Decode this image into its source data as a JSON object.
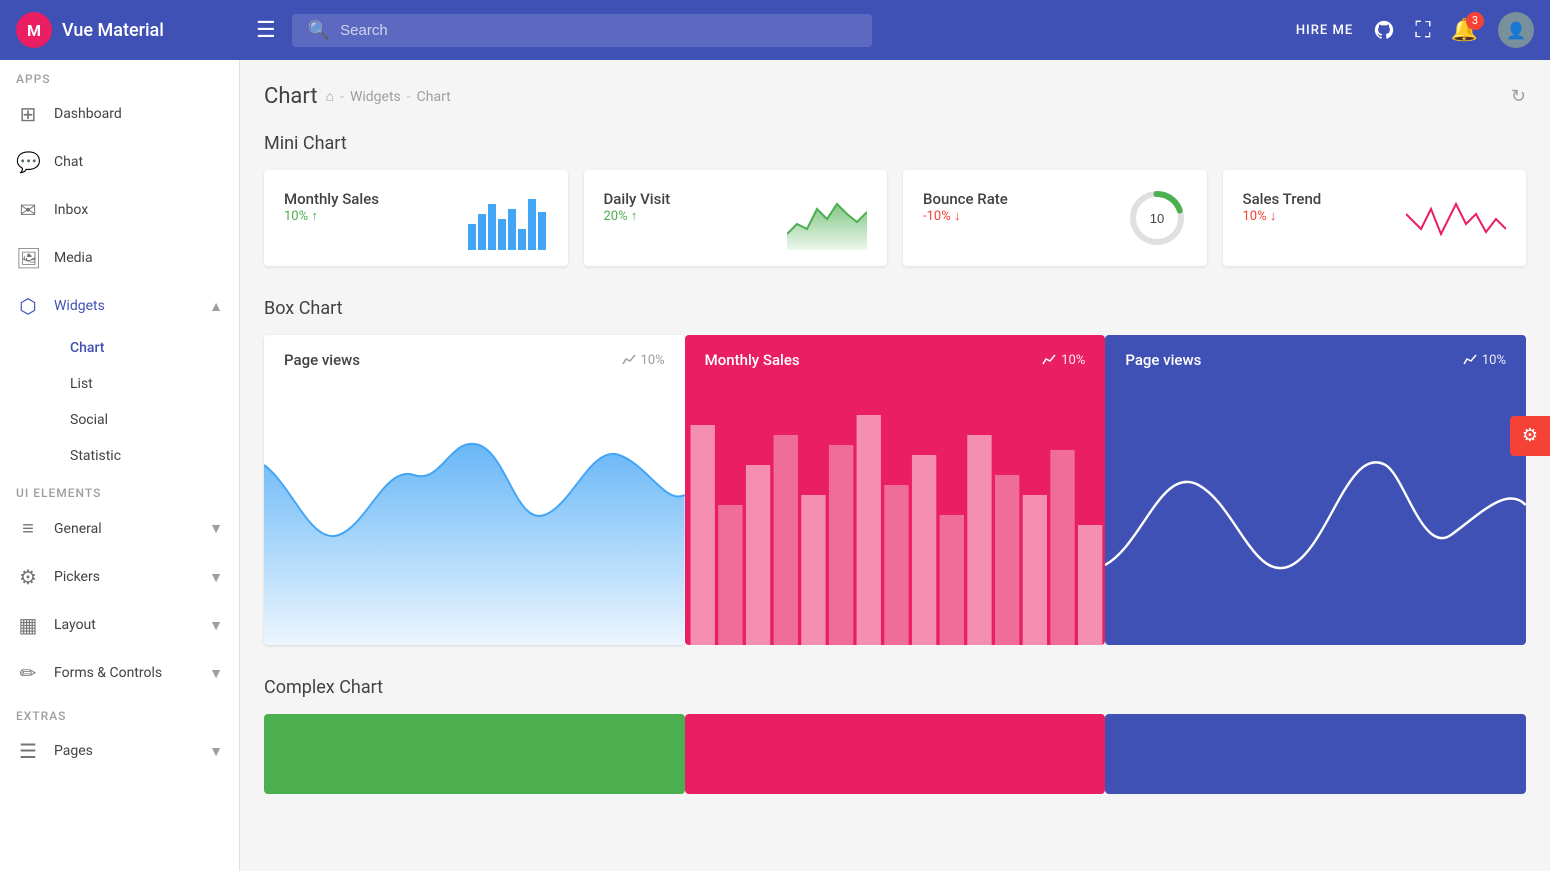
{
  "app": {
    "logo_initial": "M",
    "logo_name": "Vue Material"
  },
  "topnav": {
    "menu_icon": "☰",
    "search_placeholder": "Search",
    "hire_me": "HIRE ME",
    "notification_count": "3",
    "refresh_icon": "↻"
  },
  "sidebar": {
    "apps_label": "Apps",
    "dashboard": "Dashboard",
    "chat": "Chat",
    "inbox": "Inbox",
    "media": "Media",
    "widgets": "Widgets",
    "chart": "Chart",
    "list": "List",
    "social": "Social",
    "statistic": "Statistic",
    "ui_elements_label": "UI Elements",
    "general": "General",
    "pickers": "Pickers",
    "layout": "Layout",
    "forms_controls": "Forms & Controls",
    "extras_label": "Extras",
    "pages": "Pages"
  },
  "page": {
    "title": "Chart",
    "breadcrumb_home": "⌂",
    "breadcrumb_widgets": "Widgets",
    "breadcrumb_chart": "Chart"
  },
  "mini_charts": {
    "title": "Mini Chart",
    "cards": [
      {
        "label": "Monthly Sales",
        "value": "10%",
        "trend": "up",
        "type": "bar"
      },
      {
        "label": "Daily Visit",
        "value": "20%",
        "trend": "up",
        "type": "area_green"
      },
      {
        "label": "Bounce Rate",
        "value": "-10%",
        "trend": "down",
        "type": "gauge",
        "gauge_value": "10"
      },
      {
        "label": "Sales Trend",
        "value": "10%",
        "trend": "down",
        "type": "line_red"
      }
    ]
  },
  "box_charts": {
    "title": "Box Chart",
    "cards": [
      {
        "label": "Page views",
        "pct": "10%",
        "theme": "white",
        "type": "area_blue"
      },
      {
        "label": "Monthly Sales",
        "pct": "10%",
        "theme": "pink",
        "type": "bar_pink"
      },
      {
        "label": "Page views",
        "pct": "10%",
        "theme": "blue",
        "type": "line_white"
      }
    ]
  },
  "complex_charts": {
    "title": "Complex Chart"
  },
  "fab": {
    "icon": "⚙"
  }
}
